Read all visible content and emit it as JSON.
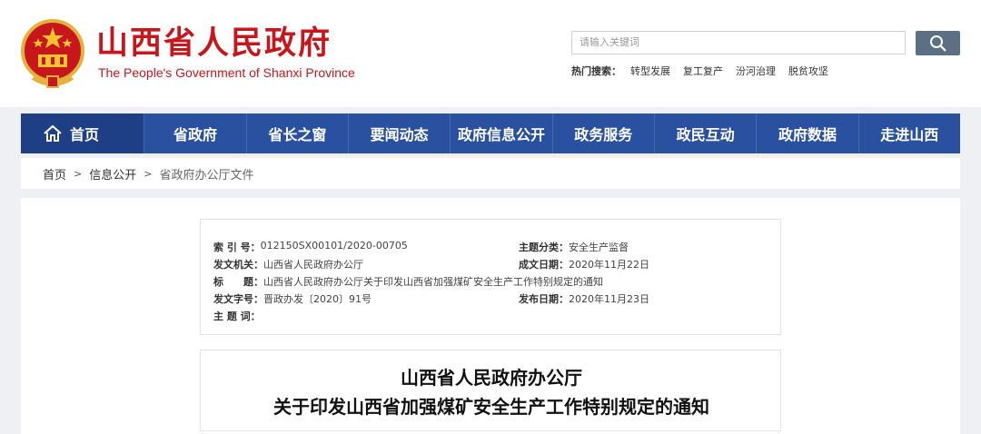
{
  "header": {
    "title": "山西省人民政府",
    "subtitle": "The People's Government of Shanxi Province",
    "search_placeholder": "请输入关键词",
    "hot_label": "热门搜索：",
    "hot_items": [
      "转型发展",
      "复工复产",
      "汾河治理",
      "脱贫攻坚"
    ]
  },
  "nav": {
    "items": [
      "首页",
      "省政府",
      "省长之窗",
      "要闻动态",
      "政府信息公开",
      "政务服务",
      "政民互动",
      "政府数据",
      "走进山西"
    ]
  },
  "breadcrumb": {
    "items": [
      "首页",
      "信息公开",
      "省政府办公厅文件"
    ],
    "separator": ">"
  },
  "meta": {
    "index_label": "索 引 号：",
    "index_value": "012150SX00101/2020-00705",
    "category_label": "主题分类：",
    "category_value": "安全生产监督",
    "issuer_label": "发文机关：",
    "issuer_value": "山西省人民政府办公厅",
    "created_label": "成文日期：",
    "created_value": "2020年11月22日",
    "title_label": "标　　题：",
    "title_value": "山西省人民政府办公厅关于印发山西省加强煤矿安全生产工作特别规定的通知",
    "docno_label": "发文字号：",
    "docno_value": "晋政办发〔2020〕91号",
    "published_label": "发布日期：",
    "published_value": "2020年11月23日",
    "keywords_label": "主 题 词：",
    "keywords_value": ""
  },
  "document": {
    "title_line1": "山西省人民政府办公厅",
    "title_line2": "关于印发山西省加强煤矿安全生产工作特别规定的通知"
  }
}
